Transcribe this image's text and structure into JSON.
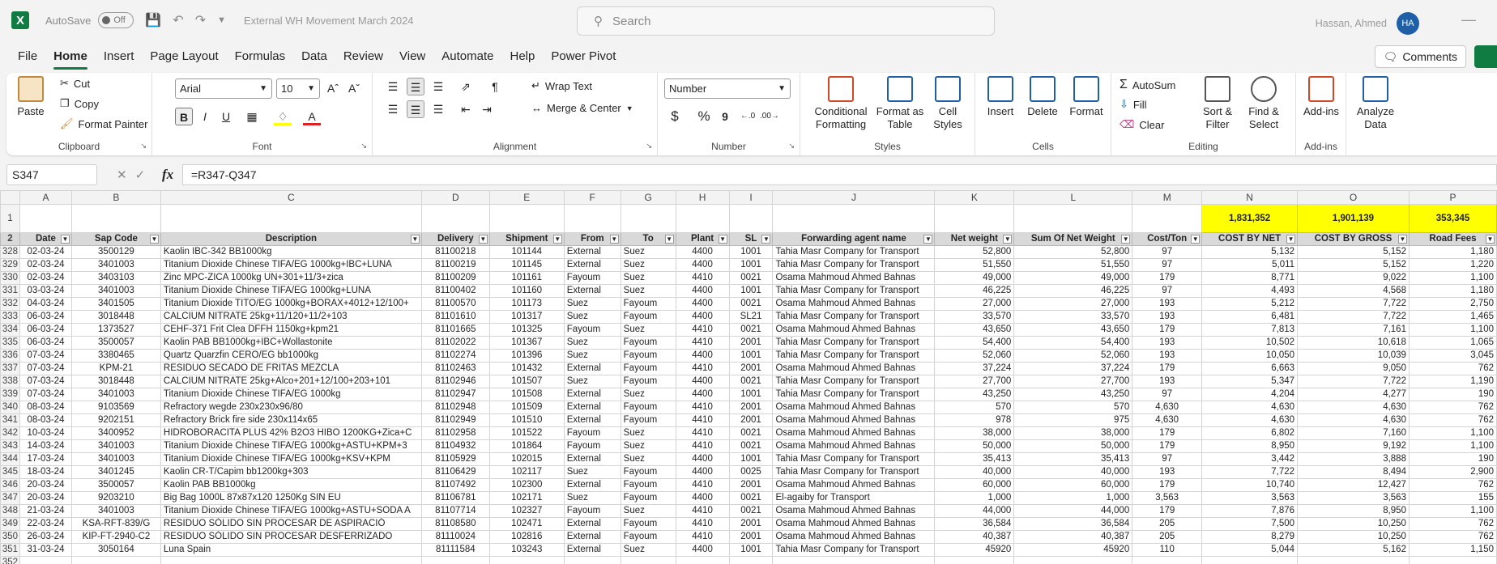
{
  "app": {
    "autosave_label": "AutoSave",
    "autosave_state": "Off",
    "doc_title": "External WH Movement March 2024",
    "search_placeholder": "Search",
    "user_name": "Hassan, Ahmed",
    "user_initials": "HA"
  },
  "menu": [
    "File",
    "Home",
    "Insert",
    "Page Layout",
    "Formulas",
    "Data",
    "Review",
    "View",
    "Automate",
    "Help",
    "Power Pivot"
  ],
  "comments_label": "Comments",
  "ribbon": {
    "clipboard": {
      "paste": "Paste",
      "cut": "Cut",
      "copy": "Copy",
      "format_painter": "Format Painter",
      "label": "Clipboard"
    },
    "font": {
      "name": "Arial",
      "size": "10",
      "bold": "B",
      "italic": "I",
      "underline": "U",
      "label": "Font"
    },
    "alignment": {
      "wrap": "Wrap Text",
      "merge": "Merge & Center",
      "label": "Alignment"
    },
    "number": {
      "format": "Number",
      "currency": "$",
      "percent": "%",
      "comma": "9",
      "label": "Number"
    },
    "styles": {
      "conditional": "Conditional Formatting",
      "format_table": "Format as Table",
      "cell_styles": "Cell Styles",
      "label": "Styles"
    },
    "cells": {
      "insert": "Insert",
      "delete": "Delete",
      "format": "Format",
      "label": "Cells"
    },
    "editing": {
      "autosum": "AutoSum",
      "fill": "Fill",
      "clear": "Clear",
      "sort": "Sort & Filter",
      "find": "Find & Select",
      "label": "Editing"
    },
    "addins": {
      "addins": "Add-ins",
      "label": "Add-ins"
    },
    "analyze": {
      "label": "Analyze Data"
    }
  },
  "formula_bar": {
    "name_box": "S347",
    "formula": "=R347-Q347"
  },
  "columns": [
    "A",
    "B",
    "C",
    "D",
    "E",
    "F",
    "G",
    "H",
    "I",
    "J",
    "K",
    "L",
    "M",
    "N",
    "O",
    "P"
  ],
  "totals": {
    "N": "1,831,352",
    "O": "1,901,139",
    "P": "353,345"
  },
  "headers": [
    "Date",
    "Sap Code",
    "Description",
    "Delivery",
    "Shipment",
    "From",
    "To",
    "Plant",
    "SL",
    "Forwarding agent name",
    "Net weight",
    "Sum Of Net Weight",
    "Cost/Ton",
    "COST BY NET",
    "COST BY GROSS",
    "Road Fees"
  ],
  "rows": [
    [
      "328",
      "02-03-24",
      "3500129",
      "Kaolin IBC-342 BB1000kg",
      "81100218",
      "101144",
      "External",
      "Suez",
      "4400",
      "1001",
      "Tahia Masr Company for Transport",
      "52,800",
      "52,800",
      "97",
      "5,132",
      "5,152",
      "1,180"
    ],
    [
      "329",
      "02-03-24",
      "3401003",
      "Titanium Dioxide Chinese TIFA/EG 1000kg+IBC+LUNA",
      "81100219",
      "101145",
      "External",
      "Suez",
      "4400",
      "1001",
      "Tahia Masr Company for Transport",
      "51,550",
      "51,550",
      "97",
      "5,011",
      "5,152",
      "1,220"
    ],
    [
      "330",
      "02-03-24",
      "3403103",
      "Zinc MPC-ZICA 1000kg UN+301+11/3+zica",
      "81100209",
      "101161",
      "Fayoum",
      "Suez",
      "4410",
      "0021",
      "Osama Mahmoud Ahmed Bahnas",
      "49,000",
      "49,000",
      "179",
      "8,771",
      "9,022",
      "1,100"
    ],
    [
      "331",
      "03-03-24",
      "3401003",
      "Titanium Dioxide Chinese TIFA/EG 1000kg+LUNA",
      "81100402",
      "101160",
      "External",
      "Suez",
      "4400",
      "1001",
      "Tahia Masr Company for Transport",
      "46,225",
      "46,225",
      "97",
      "4,493",
      "4,568",
      "1,180"
    ],
    [
      "332",
      "04-03-24",
      "3401505",
      "Titanium Dioxide TITO/EG 1000kg+BORAX+4012+12/100+",
      "81100570",
      "101173",
      "Suez",
      "Fayoum",
      "4400",
      "0021",
      "Osama Mahmoud Ahmed Bahnas",
      "27,000",
      "27,000",
      "193",
      "5,212",
      "7,722",
      "2,750"
    ],
    [
      "333",
      "06-03-24",
      "3018448",
      "CALCIUM NITRATE 25kg+11/120+11/2+103",
      "81101610",
      "101317",
      "Suez",
      "Fayoum",
      "4400",
      "SL21",
      "Tahia Masr Company for Transport",
      "33,570",
      "33,570",
      "193",
      "6,481",
      "7,722",
      "1,465"
    ],
    [
      "334",
      "06-03-24",
      "1373527",
      "CEHF-371 Frit Clea DFFH 1150kg+kpm21",
      "81101665",
      "101325",
      "Fayoum",
      "Suez",
      "4410",
      "0021",
      "Osama Mahmoud Ahmed Bahnas",
      "43,650",
      "43,650",
      "179",
      "7,813",
      "7,161",
      "1,100"
    ],
    [
      "335",
      "06-03-24",
      "3500057",
      "Kaolin PAB BB1000kg+IBC+Wollastonite",
      "81102022",
      "101367",
      "Suez",
      "Fayoum",
      "4410",
      "2001",
      "Tahia Masr Company for Transport",
      "54,400",
      "54,400",
      "193",
      "10,502",
      "10,618",
      "1,065"
    ],
    [
      "336",
      "07-03-24",
      "3380465",
      "Quartz Quarzfin CERO/EG bb1000kg",
      "81102274",
      "101396",
      "Suez",
      "Fayoum",
      "4400",
      "1001",
      "Tahia Masr Company for Transport",
      "52,060",
      "52,060",
      "193",
      "10,050",
      "10,039",
      "3,045"
    ],
    [
      "337",
      "07-03-24",
      "KPM-21",
      "RESIDUO SECADO DE FRITAS MEZCLA",
      "81102463",
      "101432",
      "External",
      "Fayoum",
      "4410",
      "2001",
      "Osama Mahmoud Ahmed Bahnas",
      "37,224",
      "37,224",
      "179",
      "6,663",
      "9,050",
      "762"
    ],
    [
      "338",
      "07-03-24",
      "3018448",
      "CALCIUM NITRATE 25kg+Alco+201+12/100+203+101",
      "81102946",
      "101507",
      "Suez",
      "Fayoum",
      "4400",
      "0021",
      "Tahia Masr Company for Transport",
      "27,700",
      "27,700",
      "193",
      "5,347",
      "7,722",
      "1,190"
    ],
    [
      "339",
      "07-03-24",
      "3401003",
      "Titanium Dioxide Chinese TIFA/EG 1000kg",
      "81102947",
      "101508",
      "External",
      "Suez",
      "4400",
      "1001",
      "Tahia Masr Company for Transport",
      "43,250",
      "43,250",
      "97",
      "4,204",
      "4,277",
      "190"
    ],
    [
      "340",
      "08-03-24",
      "9103569",
      "Refractory wegde 230x230x96/80",
      "81102948",
      "101509",
      "External",
      "Fayoum",
      "4410",
      "2001",
      "Osama Mahmoud Ahmed Bahnas",
      "570",
      "570",
      "4,630",
      "4,630",
      "4,630",
      "762"
    ],
    [
      "341",
      "08-03-24",
      "9202151",
      "Refractory Brick fire side 230x114x65",
      "81102949",
      "101510",
      "External",
      "Fayoum",
      "4410",
      "2001",
      "Osama Mahmoud Ahmed Bahnas",
      "978",
      "975",
      "4,630",
      "4,630",
      "4,630",
      "762"
    ],
    [
      "342",
      "10-03-24",
      "3400952",
      "HIDROBORACITA PLUS 42% B2O3 HIBO 1200KG+Zica+C",
      "81102958",
      "101522",
      "Fayoum",
      "Suez",
      "4410",
      "0021",
      "Osama Mahmoud Ahmed Bahnas",
      "38,000",
      "38,000",
      "179",
      "6,802",
      "7,160",
      "1,100"
    ],
    [
      "343",
      "14-03-24",
      "3401003",
      "Titanium Dioxide Chinese TIFA/EG 1000kg+ASTU+KPM+3",
      "81104932",
      "101864",
      "Fayoum",
      "Suez",
      "4410",
      "0021",
      "Osama Mahmoud Ahmed Bahnas",
      "50,000",
      "50,000",
      "179",
      "8,950",
      "9,192",
      "1,100"
    ],
    [
      "344",
      "17-03-24",
      "3401003",
      "Titanium Dioxide Chinese TIFA/EG 1000kg+KSV+KPM",
      "81105929",
      "102015",
      "External",
      "Suez",
      "4400",
      "1001",
      "Tahia Masr Company for Transport",
      "35,413",
      "35,413",
      "97",
      "3,442",
      "3,888",
      "190"
    ],
    [
      "345",
      "18-03-24",
      "3401245",
      "Kaolin CR-T/Capim bb1200kg+303",
      "81106429",
      "102117",
      "Suez",
      "Fayoum",
      "4400",
      "0025",
      "Tahia Masr Company for Transport",
      "40,000",
      "40,000",
      "193",
      "7,722",
      "8,494",
      "2,900"
    ],
    [
      "346",
      "20-03-24",
      "3500057",
      "Kaolin PAB BB1000kg",
      "81107492",
      "102300",
      "External",
      "Fayoum",
      "4410",
      "2001",
      "Osama Mahmoud Ahmed Bahnas",
      "60,000",
      "60,000",
      "179",
      "10,740",
      "12,427",
      "762"
    ],
    [
      "347",
      "20-03-24",
      "9203210",
      "Big Bag 1000L 87x87x120 1250Kg SIN EU",
      "81106781",
      "102171",
      "Suez",
      "Fayoum",
      "4400",
      "0021",
      "El-agaiby for Transport",
      "1,000",
      "1,000",
      "3,563",
      "3,563",
      "3,563",
      "155"
    ],
    [
      "348",
      "21-03-24",
      "3401003",
      "Titanium Dioxide Chinese TIFA/EG 1000kg+ASTU+SODA A",
      "81107714",
      "102327",
      "Fayoum",
      "Suez",
      "4410",
      "0021",
      "Osama Mahmoud Ahmed Bahnas",
      "44,000",
      "44,000",
      "179",
      "7,876",
      "8,950",
      "1,100"
    ],
    [
      "349",
      "22-03-24",
      "KSA-RFT-839/G",
      "RESIDUO SÓLIDO SIN PROCESAR DE ASPIRACIÓ",
      "81108580",
      "102471",
      "External",
      "Fayoum",
      "4410",
      "2001",
      "Osama Mahmoud Ahmed Bahnas",
      "36,584",
      "36,584",
      "205",
      "7,500",
      "10,250",
      "762"
    ],
    [
      "350",
      "26-03-24",
      "KIP-FT-2940-C2",
      "RESIDUO SÓLIDO SIN PROCESAR DESFERRIZADO",
      "81110024",
      "102816",
      "External",
      "Fayoum",
      "4410",
      "2001",
      "Osama Mahmoud Ahmed Bahnas",
      "40,387",
      "40,387",
      "205",
      "8,279",
      "10,250",
      "762"
    ],
    [
      "351",
      "31-03-24",
      "3050164",
      "Luna Spain",
      "81111584",
      "103243",
      "External",
      "Suez",
      "4400",
      "1001",
      "Tahia Masr Company for Transport",
      "45920",
      "45920",
      "110",
      "5,044",
      "5,162",
      "1,150"
    ]
  ],
  "next_row_number": "352"
}
